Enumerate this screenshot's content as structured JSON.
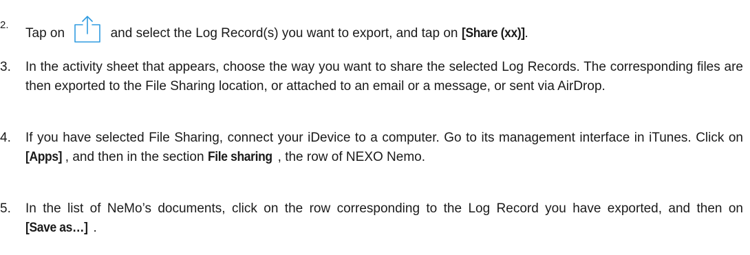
{
  "steps": [
    {
      "number": "2.",
      "text_before_icon": "Tap on",
      "icon": "share-icon",
      "text_after_icon": "and select the Log Record(s) you want to export, and tap on",
      "bold": "[Share (xx)]",
      "text_end": "."
    },
    {
      "number": "3.",
      "text": "In the activity sheet that appears, choose the way you want to share the selected Log Records. The corresponding files are then exported to the File Sharing location, or attached to an email or a message, or sent via AirDrop."
    },
    {
      "number": "4.",
      "text_1": "If you have selected File Sharing, connect your iDevice to a computer. Go to its management interface in iTunes. Click on",
      "bold_1": "[Apps]",
      "text_2": ", and then in the section",
      "bold_2": "File sharing",
      "text_3": ", the row of NEXO Nemo."
    },
    {
      "number": "5.",
      "text_1": "In the list of NeMo’s documents, click on the row corresponding to the Log Record you have exported, and then on",
      "bold_1": "[Save as…]",
      "text_2": "."
    }
  ],
  "colors": {
    "text": "#1a1a1a",
    "icon": "#2f9be0"
  }
}
